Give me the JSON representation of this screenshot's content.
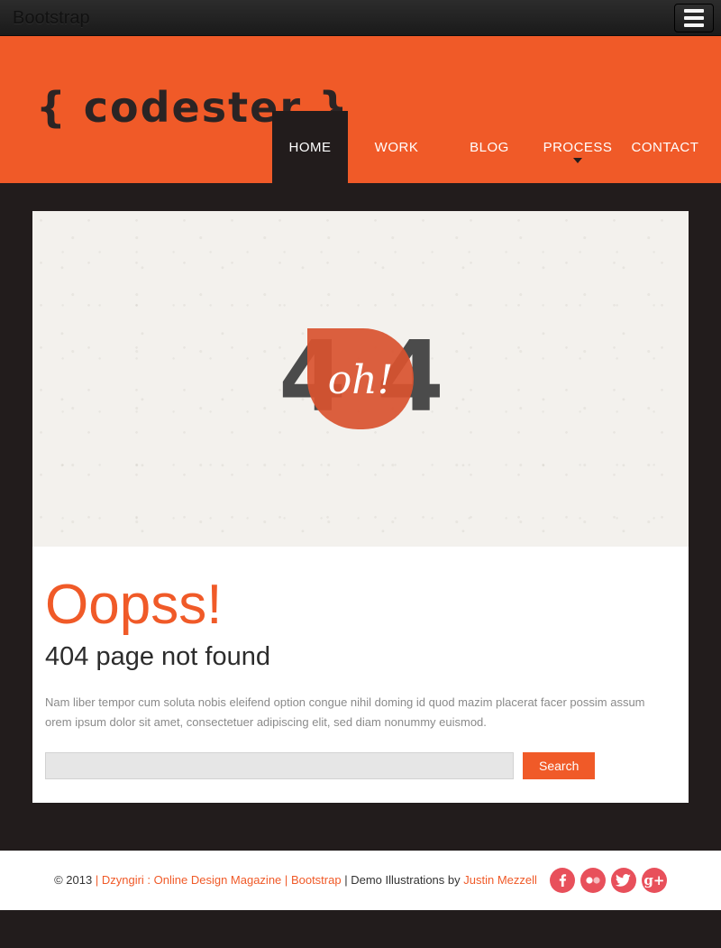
{
  "topbar": {
    "brand": "Bootstrap",
    "menu_icon": "hamburger-icon"
  },
  "header": {
    "logo": "{ codester }",
    "accent_color": "#f05a28",
    "dark_color": "#221c1c",
    "nav": [
      {
        "label": "HOME",
        "active": true,
        "has_caret": false
      },
      {
        "label": "WORK",
        "active": false,
        "has_caret": false
      },
      {
        "label": "BLOG",
        "active": false,
        "has_caret": false
      },
      {
        "label": "PROCESS",
        "active": false,
        "has_caret": true
      },
      {
        "label": "CONTACT",
        "active": false,
        "has_caret": false
      }
    ]
  },
  "hero": {
    "digits": "4       4",
    "badge": "oh!",
    "badge_color": "#d9522f",
    "digit_color": "#4b4b4b",
    "background_color": "#f3f1ed"
  },
  "content": {
    "headline": "Oopss!",
    "subtitle": "404 page not found",
    "paragraph": "Nam liber tempor cum soluta nobis eleifend option congue nihil doming id quod mazim placerat facer possim assum orem ipsum dolor sit amet, consectetuer adipiscing elit, sed diam nonummy euismod.",
    "search": {
      "value": "",
      "placeholder": "",
      "button_label": "Search"
    }
  },
  "footer": {
    "copyright": "© 2013",
    "sep": "|",
    "link_dzyngiri": "Dzyngiri : Online Design Magazine",
    "link_bootstrap": "Bootstrap",
    "credit_prefix": "Demo Illustrations by",
    "link_author": "Justin Mezzell",
    "social_color": "#e8505b",
    "socials": [
      {
        "name": "facebook-icon",
        "label": "f"
      },
      {
        "name": "flickr-icon",
        "label": "••"
      },
      {
        "name": "twitter-icon",
        "label": "t"
      },
      {
        "name": "google-plus-icon",
        "label": "g+"
      }
    ]
  }
}
